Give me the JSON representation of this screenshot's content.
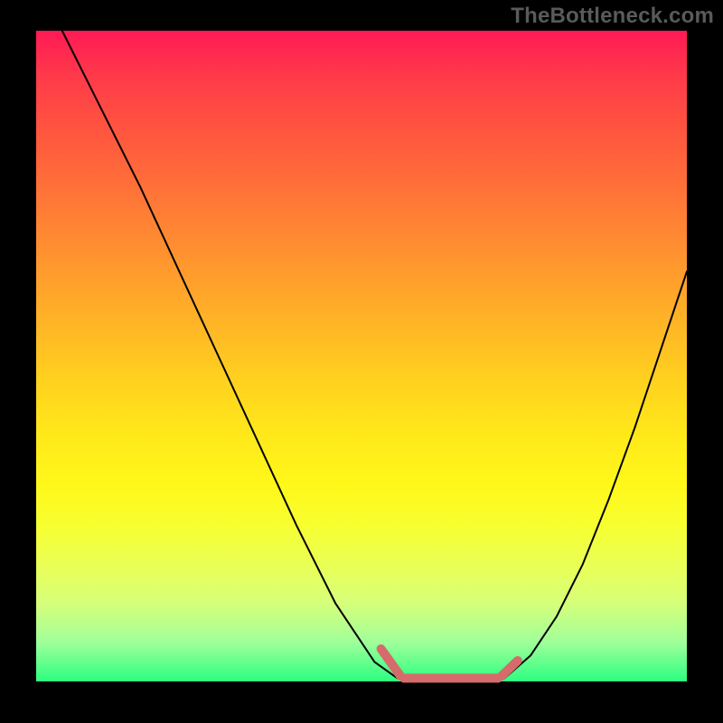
{
  "watermark": "TheBottleneck.com",
  "colors": {
    "curve": "#000000",
    "accent": "#d66b6b",
    "frame": "#000000"
  },
  "chart_data": {
    "type": "line",
    "title": "",
    "xlabel": "",
    "ylabel": "",
    "xlim": [
      0,
      100
    ],
    "ylim": [
      0,
      100
    ],
    "grid": false,
    "legend": false,
    "series": [
      {
        "name": "left_curve",
        "x": [
          4,
          10,
          16,
          22,
          28,
          34,
          40,
          46,
          52,
          55.5
        ],
        "y": [
          100,
          88,
          76,
          63,
          50,
          37,
          24,
          12,
          3,
          0.5
        ]
      },
      {
        "name": "right_curve",
        "x": [
          72,
          76,
          80,
          84,
          88,
          92,
          96,
          100
        ],
        "y": [
          0.5,
          4,
          10,
          18,
          28,
          39,
          51,
          63
        ]
      },
      {
        "name": "accent_overlay",
        "segments": [
          {
            "id": "left",
            "x": [
              53,
              56
            ],
            "y": [
              5,
              0.8
            ]
          },
          {
            "id": "flat",
            "x": [
              56.5,
              71
            ],
            "y": [
              0.5,
              0.5
            ]
          },
          {
            "id": "right",
            "x": [
              71.5,
              74
            ],
            "y": [
              0.8,
              3.2
            ]
          }
        ],
        "stroke_width_px": 10
      }
    ],
    "background_gradient": "vertical red→yellow→green"
  }
}
